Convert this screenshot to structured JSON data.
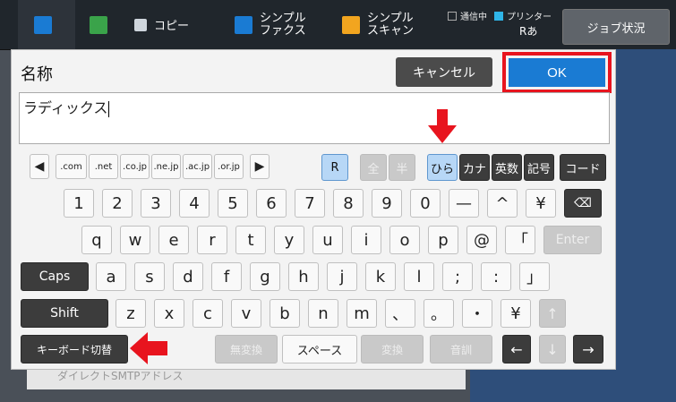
{
  "topbar": {
    "copy_label": "コピー",
    "fax_label_1": "シンプル",
    "fax_label_2": "ファクス",
    "scan_label_1": "シンプル",
    "scan_label_2": "スキャン",
    "status_comm": "通信中",
    "status_printer": "プリンター",
    "printer_mode": "Rあ",
    "job_status": "ジョブ状況"
  },
  "dialog": {
    "title": "名称",
    "cancel": "キャンセル",
    "ok": "OK",
    "name_value": "ラディックス"
  },
  "domain_row": {
    "keys": [
      ".com",
      ".net",
      ".co.jp",
      ".ne.jp",
      ".ac.jp",
      ".or.jp"
    ],
    "left_arrow": "◀",
    "right_arrow": "▶"
  },
  "mode_row": {
    "r": "R",
    "full": "全",
    "half": "半",
    "hira": "ひら",
    "kana": "カナ",
    "eisu": "英数",
    "kigo": "記号",
    "code": "コード"
  },
  "rows": {
    "numbers": [
      "1",
      "2",
      "3",
      "4",
      "5",
      "6",
      "7",
      "8",
      "9",
      "0",
      "—",
      "^",
      "¥"
    ],
    "row_q": [
      "q",
      "w",
      "e",
      "r",
      "t",
      "y",
      "u",
      "i",
      "o",
      "p",
      "@",
      "「"
    ],
    "row_a": [
      "a",
      "s",
      "d",
      "f",
      "g",
      "h",
      "j",
      "k",
      "l",
      ";",
      ":",
      "」"
    ],
    "row_z": [
      "z",
      "x",
      "c",
      "v",
      "b",
      "n",
      "m",
      "、",
      "。",
      "・",
      "¥"
    ]
  },
  "special": {
    "enter": "Enter",
    "caps": "Caps",
    "shift": "Shift",
    "keyboard_switch": "キーボード切替",
    "muhenkan": "無変換",
    "space": "スペース",
    "henkan": "変換",
    "onkun": "音訓",
    "backspace": "⌫",
    "up": "↑",
    "down": "↓",
    "left": "←",
    "right": "→"
  },
  "background": {
    "bottom_text": "ダイレクトSMTPアドレス"
  },
  "colors": {
    "accent": "#1a7bd3",
    "highlight": "#e8141e",
    "selected_key": "#b7d7f6"
  }
}
